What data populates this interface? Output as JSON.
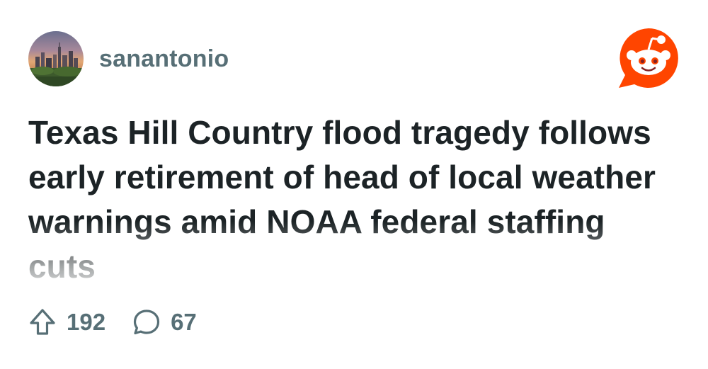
{
  "post": {
    "community": "sanantonio",
    "title": "Texas Hill Country flood tragedy follows early retirement of head of local weather warnings amid NOAA federal staffing cuts",
    "upvotes": "192",
    "comments": "67"
  },
  "colors": {
    "brand": "#ff4500",
    "meta_text": "#576f76",
    "title_text": "#1c2326"
  },
  "icons": {
    "avatar": "san-antonio-skyline-avatar",
    "logo": "reddit-snoo-logo",
    "upvote": "upvote-arrow-icon",
    "comment": "comment-bubble-icon"
  }
}
